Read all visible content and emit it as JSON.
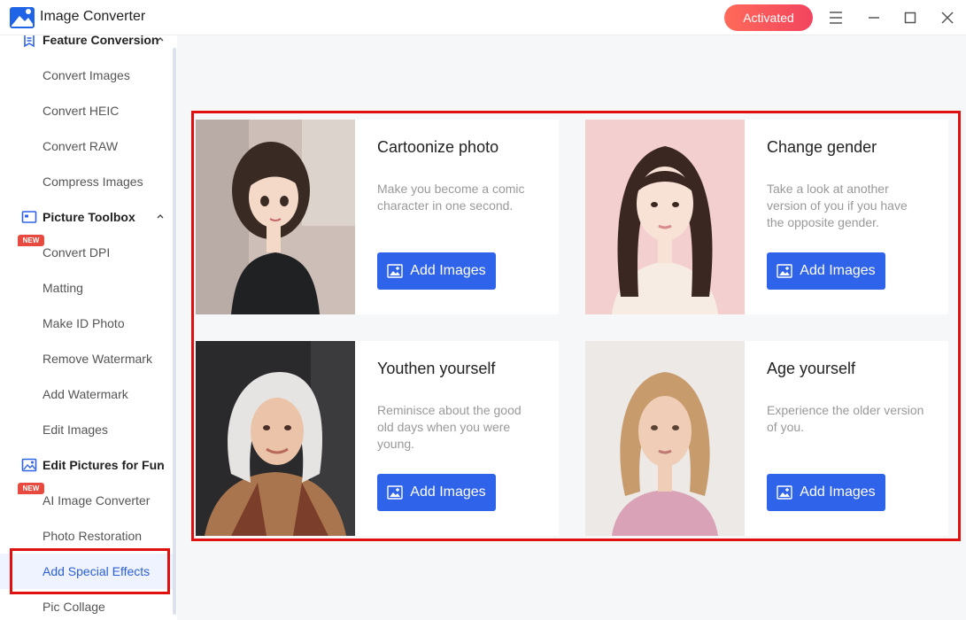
{
  "app": {
    "title": "Image Converter",
    "activated_label": "Activated"
  },
  "colors": {
    "accent": "#2f63e9",
    "activated": "#f2445e",
    "highlight": "#e01010",
    "new_badge": "#e94a3f"
  },
  "sidebar": {
    "groups": [
      {
        "label": "Feature Conversion",
        "icon": "feature-conversion-icon"
      },
      {
        "label": "Picture Toolbox",
        "icon": "toolbox-icon"
      },
      {
        "label": "Edit Pictures for Fun",
        "icon": "picture-edit-icon"
      }
    ],
    "items": [
      {
        "label": "Convert Images"
      },
      {
        "label": "Convert HEIC"
      },
      {
        "label": "Convert RAW"
      },
      {
        "label": "Compress Images"
      },
      {
        "label": "Convert DPI",
        "badge": "NEW"
      },
      {
        "label": "Matting"
      },
      {
        "label": "Make ID Photo"
      },
      {
        "label": "Remove Watermark"
      },
      {
        "label": "Add Watermark"
      },
      {
        "label": "Edit Images"
      },
      {
        "label": "AI Image Converter",
        "badge": "NEW"
      },
      {
        "label": "Photo Restoration"
      },
      {
        "label": "Add Special Effects",
        "active": true
      },
      {
        "label": "Pic Collage"
      }
    ]
  },
  "cards": [
    {
      "title": "Cartoonize photo",
      "desc": "Make you become a comic character in one second.",
      "button": "Add Images"
    },
    {
      "title": "Change gender",
      "desc": "Take a look at another version of you if you have the opposite gender.",
      "button": "Add Images"
    },
    {
      "title": "Youthen yourself",
      "desc": "Reminisce about the good old days when you were young.",
      "button": "Add Images"
    },
    {
      "title": "Age yourself",
      "desc": "Experience the older version of you.",
      "button": "Add Images"
    }
  ]
}
